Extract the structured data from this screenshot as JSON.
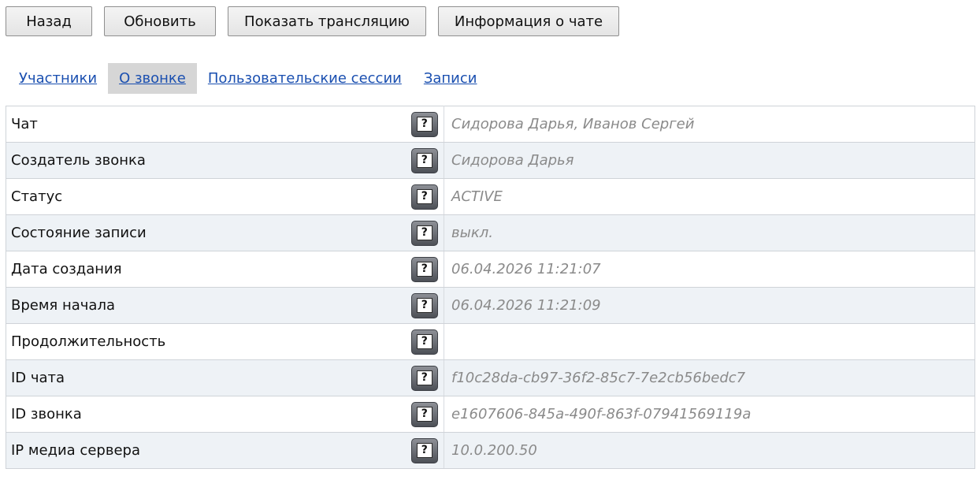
{
  "toolbar": {
    "buttons": [
      {
        "label": "Назад"
      },
      {
        "label": "Обновить"
      },
      {
        "label": "Показать трансляцию"
      },
      {
        "label": "Информация о чате"
      }
    ]
  },
  "tabs": [
    {
      "label": "Участники",
      "active": false
    },
    {
      "label": "О звонке",
      "active": true
    },
    {
      "label": "Пользовательские сессии",
      "active": false
    },
    {
      "label": "Записи",
      "active": false
    }
  ],
  "help_icon": {
    "glyph": "?",
    "name": "help-icon"
  },
  "rows": [
    {
      "label": "Чат",
      "value": "Сидорова Дарья, Иванов Сергей"
    },
    {
      "label": "Создатель звонка",
      "value": "Сидорова Дарья"
    },
    {
      "label": "Статус",
      "value": "ACTIVE"
    },
    {
      "label": "Состояние записи",
      "value": "выкл."
    },
    {
      "label": "Дата создания",
      "value": "06.04.2026 11:21:07"
    },
    {
      "label": "Время начала",
      "value": "06.04.2026 11:21:09"
    },
    {
      "label": "Продолжительность",
      "value": ""
    },
    {
      "label": "ID чата",
      "value": "f10c28da-cb97-36f2-85c7-7e2cb56bedc7"
    },
    {
      "label": "ID звонка",
      "value": "e1607606-845a-490f-863f-07941569119a"
    },
    {
      "label": "IP медиа сервера",
      "value": "10.0.200.50"
    }
  ]
}
